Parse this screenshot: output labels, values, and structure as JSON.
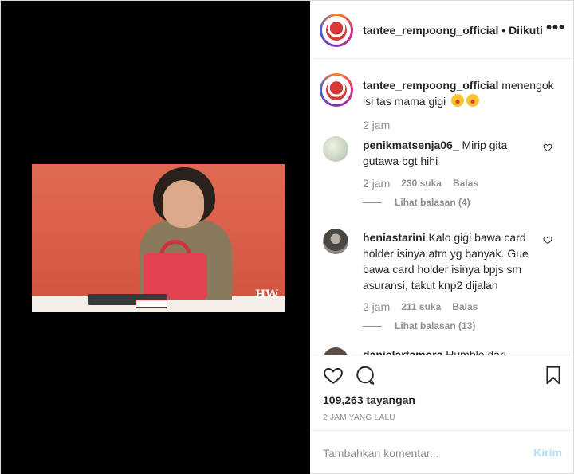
{
  "header": {
    "username": "tantee_rempoong_official",
    "separator": "•",
    "follow_status": "Diikuti",
    "more_label": "•••"
  },
  "media": {
    "watermark": "HW"
  },
  "caption": {
    "username": "tantee_rempoong_official",
    "text": "menengok isi tas mama gigi",
    "emojis": [
      "star-struck-emoji",
      "star-struck-emoji"
    ],
    "time": "2 jam"
  },
  "comments": [
    {
      "username": "penikmatsenja06_",
      "text": "Mirip gita gutawa bgt hihi",
      "time": "2 jam",
      "likes": "230 suka",
      "reply_label": "Balas",
      "view_replies": "Lihat balasan (4)"
    },
    {
      "username": "heniastarini",
      "text": "Kalo gigi bawa card holder isinya atm yg banyak. Gue bawa card holder isinya bpjs sm asuransi, takut knp2 dijalan",
      "time": "2 jam",
      "likes": "211 suka",
      "reply_label": "Balas",
      "view_replies": "Lihat balasan (13)"
    },
    {
      "username": "danielartamora",
      "text": "Humble dari"
    }
  ],
  "stats": {
    "views": "109,263",
    "views_label": "tayangan",
    "posted_ago": "2 JAM YANG LALU"
  },
  "add_comment": {
    "placeholder": "Tambahkan komentar...",
    "post_label": "Kirim"
  },
  "colors": {
    "link_disabled": "#b2dffc",
    "muted": "#8e8e8e",
    "text": "#262626",
    "video_bg": "#d9604b"
  }
}
